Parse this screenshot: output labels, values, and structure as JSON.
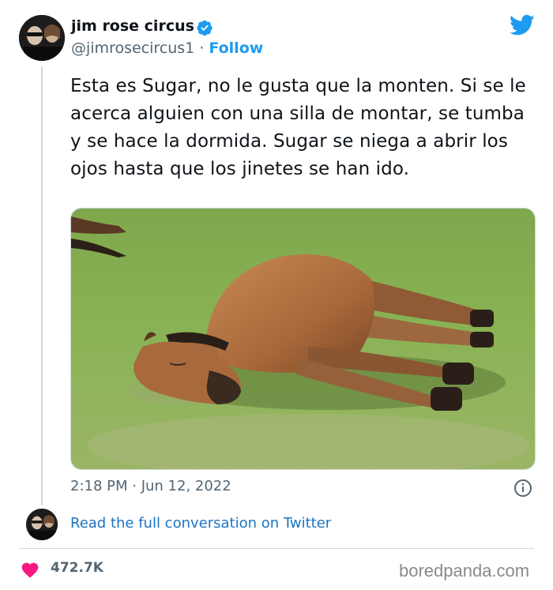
{
  "tweet": {
    "display_name": "jim rose circus",
    "handle": "@jimrosecircus1",
    "separator": " · ",
    "follow_label": "Follow",
    "text": "Esta es Sugar, no le gusta que la monten. Si se le acerca alguien con una silla de montar, se tumba y se hace la dormida. Sugar se niega a abrir los ojos hasta que los jinetes se han ido.",
    "timestamp": "2:18 PM · Jun 12, 2022",
    "read_conversation": "Read the full conversation on Twitter",
    "like_count": "472.7K"
  },
  "media": {
    "description_icon": "photo-of-horse-lying-on-grass"
  },
  "watermark": "boredpanda.com",
  "colors": {
    "twitter_blue": "#1d9bf0",
    "link_blue": "#1b74c4",
    "secondary_text": "#536471",
    "heart_pink": "#f91880",
    "verified_blue": "#1d9bf0"
  },
  "icons": [
    "verified-badge-icon",
    "twitter-bird-icon",
    "info-icon",
    "heart-icon"
  ]
}
